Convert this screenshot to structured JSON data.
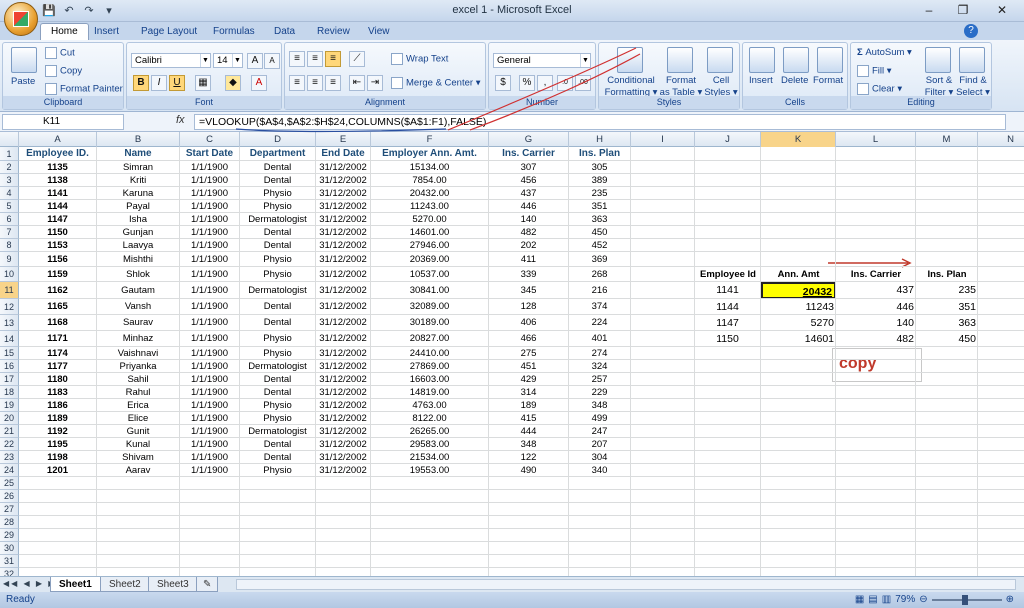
{
  "window": {
    "title": "excel 1 - Microsoft Excel",
    "min": "–",
    "restore": "❐",
    "close": "✕"
  },
  "qat": [
    "💾",
    "↶",
    "↷",
    "▾"
  ],
  "tabs": [
    "Home",
    "Insert",
    "Page Layout",
    "Formulas",
    "Data",
    "Review",
    "View"
  ],
  "ribbon": {
    "clipboard": {
      "label": "Clipboard",
      "paste": "Paste",
      "cut": "Cut",
      "copy": "Copy",
      "format_painter": "Format Painter"
    },
    "font": {
      "label": "Font",
      "name": "Calibri",
      "size": "14",
      "bold": "B",
      "italic": "I",
      "underline": "U"
    },
    "alignment": {
      "label": "Alignment",
      "wrap": "Wrap Text",
      "merge": "Merge & Center"
    },
    "number": {
      "label": "Number",
      "format": "General",
      "currency": "$",
      "percent": "%",
      "comma": ","
    },
    "styles": {
      "label": "Styles",
      "cond1": "Conditional",
      "cond2": "Formatting",
      "fmt1": "Format",
      "fmt2": "as Table",
      "cell1": "Cell",
      "cell2": "Styles"
    },
    "cells": {
      "label": "Cells",
      "insert": "Insert",
      "delete": "Delete",
      "format": "Format"
    },
    "editing": {
      "label": "Editing",
      "autosum": "AutoSum",
      "fill": "Fill",
      "clear": "Clear",
      "sort1": "Sort &",
      "sort2": "Filter",
      "find1": "Find &",
      "find2": "Select"
    }
  },
  "formula_bar": {
    "name_box": "K11",
    "fx": "fx",
    "formula": "=VLOOKUP($A$4,$A$2:$H$24,COLUMNS($A$1:F1),FALSE)"
  },
  "columns": [
    "A",
    "B",
    "C",
    "D",
    "E",
    "F",
    "G",
    "H",
    "I",
    "J",
    "K",
    "L",
    "M",
    "N"
  ],
  "rows": [
    "1",
    "2",
    "3",
    "4",
    "5",
    "6",
    "7",
    "8",
    "9",
    "10",
    "11",
    "12",
    "13",
    "14",
    "15",
    "16",
    "17",
    "18",
    "19",
    "20",
    "21",
    "22",
    "23",
    "24",
    "25",
    "26",
    "27",
    "28",
    "29",
    "30",
    "31",
    "32"
  ],
  "table": {
    "headers": [
      "Employee ID.",
      "Name",
      "Start Date",
      "Department",
      "End Date",
      "Employer Ann. Amt.",
      "Ins. Carrier",
      "Ins. Plan"
    ],
    "rows": [
      [
        "1135",
        "Simran",
        "1/1/1900",
        "Dental",
        "31/12/2002",
        "15134.00",
        "307",
        "305"
      ],
      [
        "1138",
        "Kriti",
        "1/1/1900",
        "Dental",
        "31/12/2002",
        "7854.00",
        "456",
        "389"
      ],
      [
        "1141",
        "Karuna",
        "1/1/1900",
        "Physio",
        "31/12/2002",
        "20432.00",
        "437",
        "235"
      ],
      [
        "1144",
        "Payal",
        "1/1/1900",
        "Physio",
        "31/12/2002",
        "11243.00",
        "446",
        "351"
      ],
      [
        "1147",
        "Isha",
        "1/1/1900",
        "Dermatologist",
        "31/12/2002",
        "5270.00",
        "140",
        "363"
      ],
      [
        "1150",
        "Gunjan",
        "1/1/1900",
        "Dental",
        "31/12/2002",
        "14601.00",
        "482",
        "450"
      ],
      [
        "1153",
        "Laavya",
        "1/1/1900",
        "Dental",
        "31/12/2002",
        "27946.00",
        "202",
        "452"
      ],
      [
        "1156",
        "Mishthi",
        "1/1/1900",
        "Physio",
        "31/12/2002",
        "20369.00",
        "411",
        "369"
      ],
      [
        "1159",
        "Shlok",
        "1/1/1900",
        "Physio",
        "31/12/2002",
        "10537.00",
        "339",
        "268"
      ],
      [
        "1162",
        "Gautam",
        "1/1/1900",
        "Dermatologist",
        "31/12/2002",
        "30841.00",
        "345",
        "216"
      ],
      [
        "1165",
        "Vansh",
        "1/1/1900",
        "Dental",
        "31/12/2002",
        "32089.00",
        "128",
        "374"
      ],
      [
        "1168",
        "Saurav",
        "1/1/1900",
        "Dental",
        "31/12/2002",
        "30189.00",
        "406",
        "224"
      ],
      [
        "1171",
        "Minhaz",
        "1/1/1900",
        "Physio",
        "31/12/2002",
        "20827.00",
        "466",
        "401"
      ],
      [
        "1174",
        "Vaishnavi",
        "1/1/1900",
        "Physio",
        "31/12/2002",
        "24410.00",
        "275",
        "274"
      ],
      [
        "1177",
        "Priyanka",
        "1/1/1900",
        "Dermatologist",
        "31/12/2002",
        "27869.00",
        "451",
        "324"
      ],
      [
        "1180",
        "Sahil",
        "1/1/1900",
        "Dental",
        "31/12/2002",
        "16603.00",
        "429",
        "257"
      ],
      [
        "1183",
        "Rahul",
        "1/1/1900",
        "Dental",
        "31/12/2002",
        "14819.00",
        "314",
        "229"
      ],
      [
        "1186",
        "Erica",
        "1/1/1900",
        "Physio",
        "31/12/2002",
        "4763.00",
        "189",
        "348"
      ],
      [
        "1189",
        "Elice",
        "1/1/1900",
        "Physio",
        "31/12/2002",
        "8122.00",
        "415",
        "499"
      ],
      [
        "1192",
        "Gunit",
        "1/1/1900",
        "Dermatologist",
        "31/12/2002",
        "26265.00",
        "444",
        "247"
      ],
      [
        "1195",
        "Kunal",
        "1/1/1900",
        "Dental",
        "31/12/2002",
        "29583.00",
        "348",
        "207"
      ],
      [
        "1198",
        "Shivam",
        "1/1/1900",
        "Dental",
        "31/12/2002",
        "21534.00",
        "122",
        "304"
      ],
      [
        "1201",
        "Aarav",
        "1/1/1900",
        "Physio",
        "31/12/2002",
        "19553.00",
        "490",
        "340"
      ]
    ]
  },
  "lookup": {
    "headers": [
      "Employee Id",
      "Ann. Amt",
      "Ins. Carrier",
      "Ins. Plan"
    ],
    "rows": [
      [
        "1141",
        "20432",
        "437",
        "235"
      ],
      [
        "1144",
        "11243",
        "446",
        "351"
      ],
      [
        "1147",
        "5270",
        "140",
        "363"
      ],
      [
        "1150",
        "14601",
        "482",
        "450"
      ]
    ]
  },
  "annotation": {
    "copy": "copy"
  },
  "sheets": [
    "Sheet1",
    "Sheet2",
    "Sheet3"
  ],
  "status": {
    "ready": "Ready",
    "zoom": "79%"
  }
}
